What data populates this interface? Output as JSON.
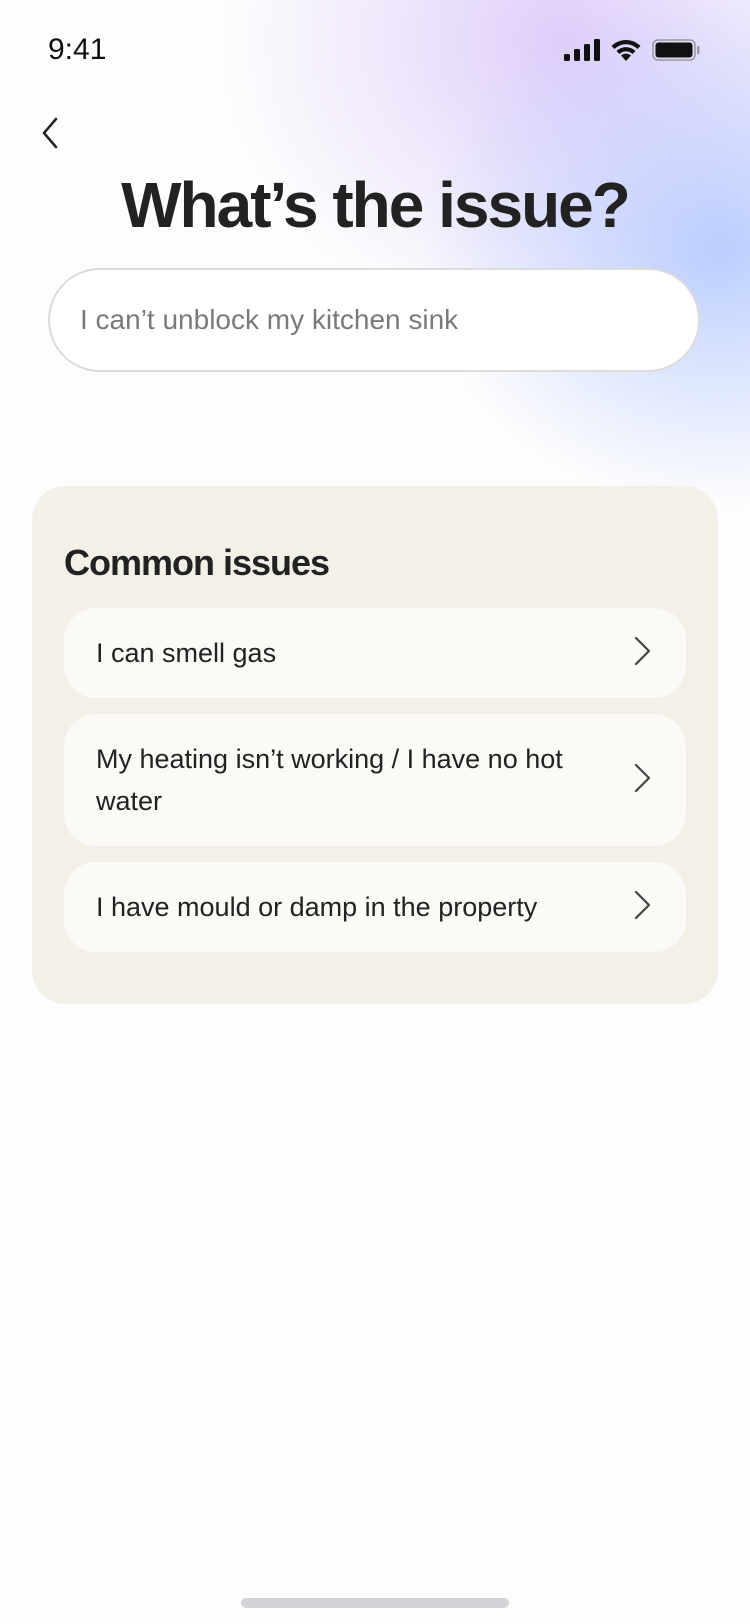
{
  "status_bar": {
    "time": "9:41",
    "icons": [
      "signal-icon",
      "wifi-icon",
      "battery-icon"
    ]
  },
  "header": {
    "back_icon": "chevron-left-icon",
    "title": "What’s the issue?"
  },
  "search": {
    "placeholder": "I can’t unblock my kitchen sink",
    "value": ""
  },
  "common_issues": {
    "heading": "Common issues",
    "items": [
      {
        "label": "I can smell gas",
        "icon": "chevron-right-icon"
      },
      {
        "label": "My heating isn’t working / I have no hot water",
        "icon": "chevron-right-icon"
      },
      {
        "label": "I have mould or damp in the property",
        "icon": "chevron-right-icon"
      }
    ]
  },
  "colors": {
    "card_background": "#f3f0e8",
    "item_background": "#fbfaf7",
    "glow_purple": "#dcc8fa",
    "glow_blue": "#b0c6ff",
    "text": "#222222"
  }
}
